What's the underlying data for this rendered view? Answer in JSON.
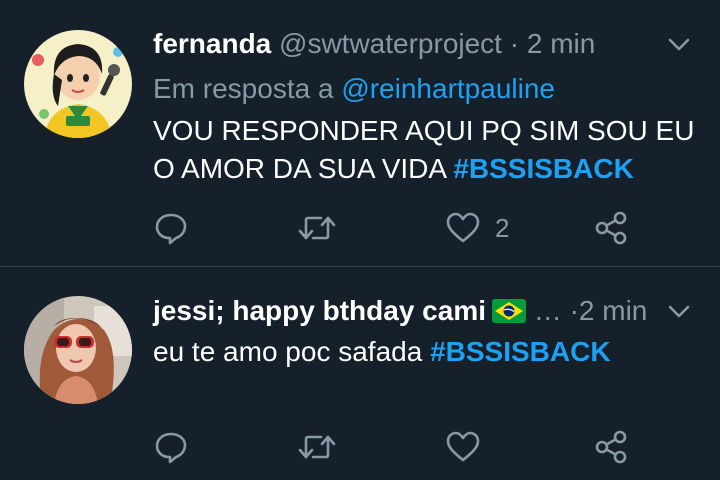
{
  "tweets": [
    {
      "name": "fernanda",
      "handle": "@swtwaterproject",
      "separator": "·",
      "time": "2 min",
      "reply_prefix": "Em resposta a",
      "reply_to": "@reinhartpauline",
      "text_line1": "VOU RESPONDER AQUI PQ SIM SOU EU",
      "text_line2": "O AMOR DA SUA VIDA",
      "hashtag": "#BSSISBACK",
      "like_count": "2",
      "icons": [
        "reply-icon",
        "retweet-icon",
        "like-icon",
        "share-icon",
        "chevron-down-icon"
      ]
    },
    {
      "name": "jessi; happy bthday cami",
      "name_emoji": "brazil-flag",
      "ellipsis": "…",
      "separator": "·",
      "time": "2 min",
      "text": "eu te amo poc safada",
      "hashtag": "#BSSISBACK",
      "icons": [
        "reply-icon",
        "retweet-icon",
        "like-icon",
        "share-icon",
        "chevron-down-icon"
      ]
    }
  ],
  "colors": {
    "background": "#15202b",
    "divider": "#38444d",
    "secondary_text": "#8899a6",
    "accent": "#1da1f2"
  }
}
